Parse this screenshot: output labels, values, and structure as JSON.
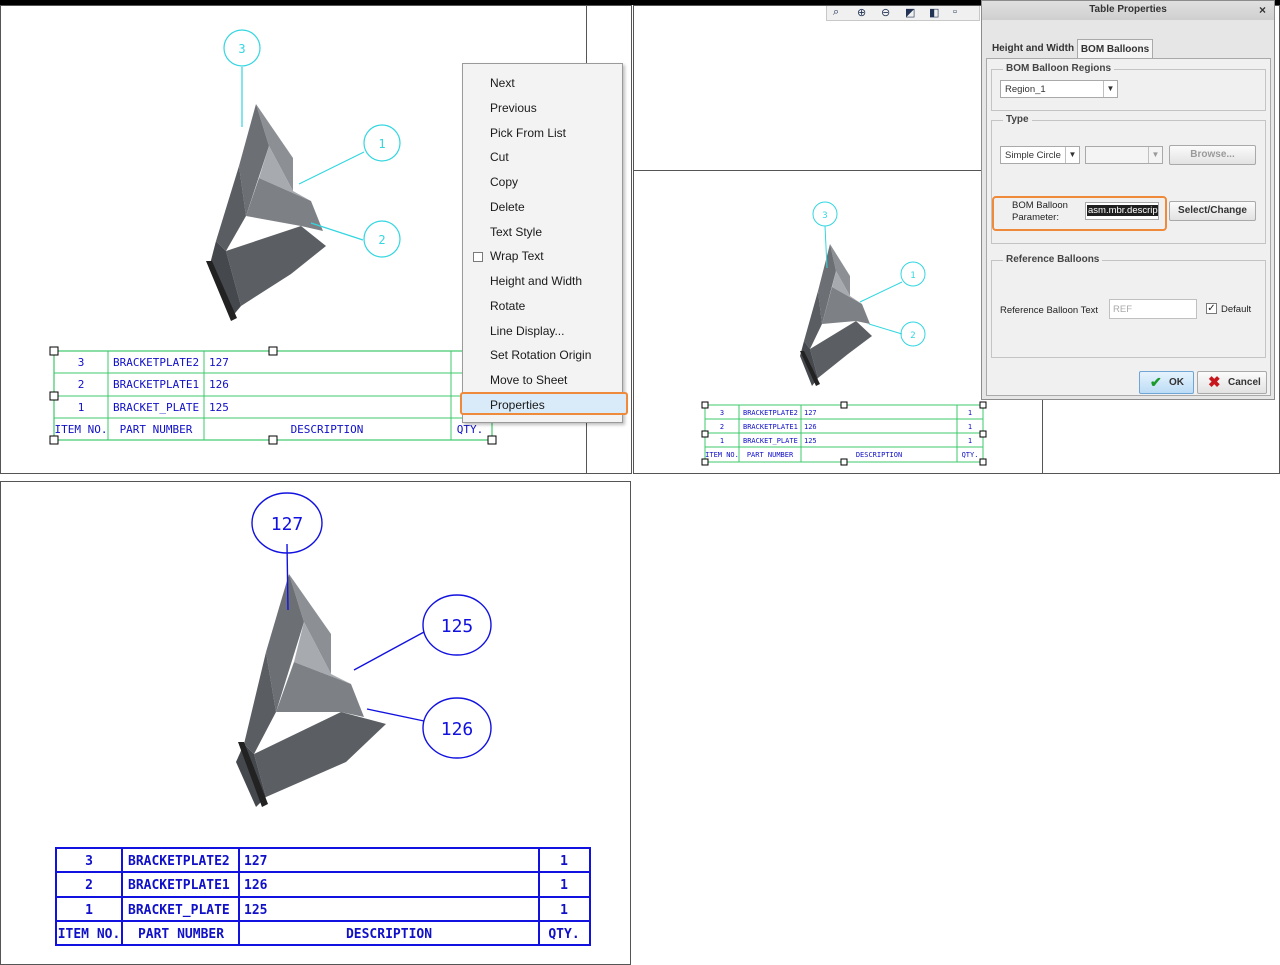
{
  "table_rows": [
    {
      "item": "3",
      "part": "BRACKETPLATE2",
      "desc": "127",
      "qty": "1"
    },
    {
      "item": "2",
      "part": "BRACKETPLATE1",
      "desc": "126",
      "qty": "1"
    },
    {
      "item": "1",
      "part": "BRACKET_PLATE",
      "desc": "125",
      "qty": "1"
    }
  ],
  "table_header": {
    "item": "ITEM NO.",
    "part": "PART NUMBER",
    "desc": "DESCRIPTION",
    "qty": "QTY."
  },
  "balloons_before": [
    "3",
    "1",
    "2"
  ],
  "balloons_after": [
    "127",
    "125",
    "126"
  ],
  "context_menu": {
    "items": [
      "Next",
      "Previous",
      "Pick From List",
      "Cut",
      "Copy",
      "Delete",
      "Text Style",
      "Wrap Text",
      "Height and Width",
      "Rotate",
      "Line Display...",
      "Set Rotation Origin",
      "Move to Sheet",
      "Properties"
    ],
    "highlighted": "Properties"
  },
  "dialog": {
    "title": "Table Properties",
    "close": "×",
    "tabs": [
      "Height and Width",
      "BOM Balloons"
    ],
    "active_tab": "BOM Balloons",
    "regions_group": "BOM Balloon Regions",
    "region_value": "Region_1",
    "type_group": "Type",
    "type_value": "Simple Circle",
    "browse_label": "Browse...",
    "param_label_line1": "BOM Balloon",
    "param_label_line2": "Parameter:",
    "param_value": "asm.mbr.descrip",
    "select_change_label": "Select/Change",
    "ref_group": "Reference Balloons",
    "ref_text_label": "Reference Balloon Text",
    "ref_text_placeholder": "REF",
    "default_label": "Default",
    "default_checked": true,
    "ok_label": "OK",
    "cancel_label": "Cancel"
  },
  "colors": {
    "balloon_cyan": "#33d6e0",
    "table_green": "#3cc86a",
    "final_blue": "#1212e0",
    "text_blue": "#1010c8",
    "highlight_orange": "#ef8a3a",
    "part_gray": "#5e6266"
  }
}
